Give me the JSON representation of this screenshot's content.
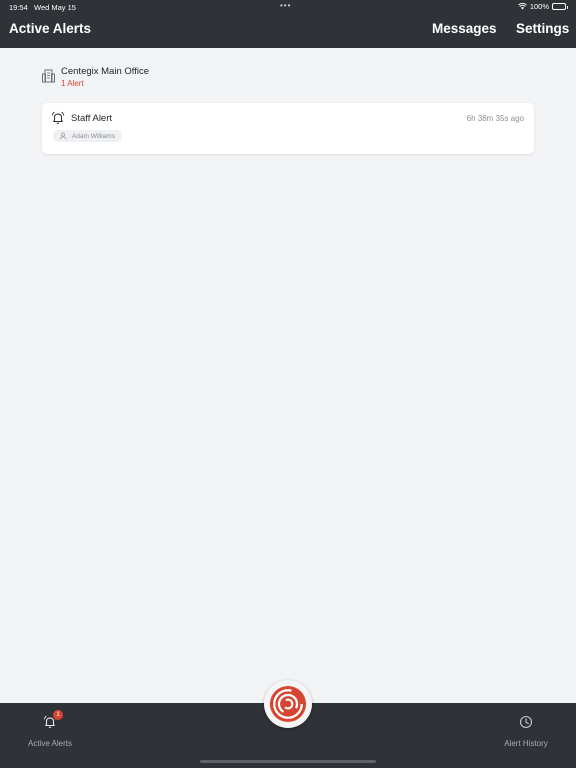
{
  "status_bar": {
    "time": "19:54",
    "date": "Wed May 15",
    "battery": "100%"
  },
  "header": {
    "title": "Active Alerts",
    "messages_label": "Messages",
    "settings_label": "Settings"
  },
  "location": {
    "name": "Centegix Main Office",
    "alert_count": "1 Alert",
    "icon": "building-icon"
  },
  "alerts": [
    {
      "type": "Staff Alert",
      "elapsed": "6h 38m 35s ago",
      "person": "Adam Williams",
      "icon": "bell-ringing-icon"
    }
  ],
  "bottom_nav": {
    "active_alerts_label": "Active Alerts",
    "active_alerts_badge": "1",
    "alert_history_label": "Alert History"
  },
  "colors": {
    "header_bg": "#2f3338",
    "page_bg": "#f2f3f5",
    "alert_red": "#d64531",
    "muted_text": "#8b9096"
  }
}
